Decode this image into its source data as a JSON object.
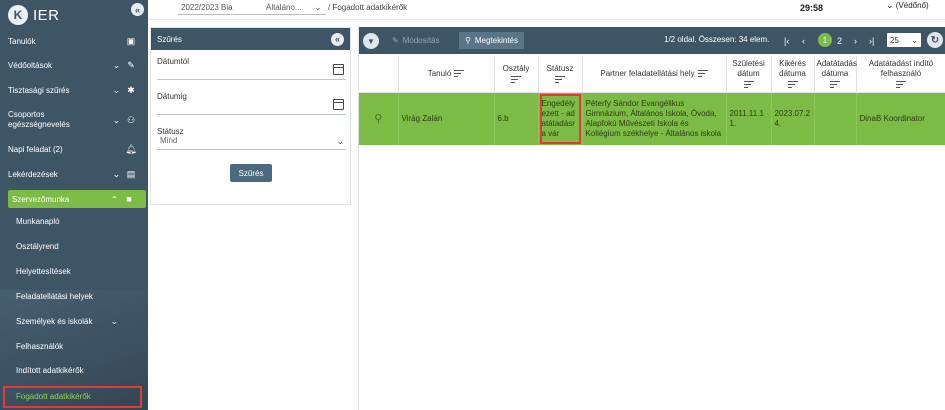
{
  "app": {
    "logo_letter": "K",
    "logo_text": "IER",
    "collapse_symbol": "«"
  },
  "sidebar": {
    "items": [
      {
        "label": "Tanulók",
        "icon": "id-card-icon"
      },
      {
        "label": "Védőoltások",
        "icon": "syringe-icon"
      },
      {
        "label": "Tisztasági szűrés",
        "icon": "bug-icon"
      },
      {
        "label": "Csoportos egészségnevelés",
        "icon": "group-icon"
      },
      {
        "label": "Napi feladat",
        "badge": "(2)",
        "icon": "bell-icon"
      },
      {
        "label": "Lekérdezések",
        "icon": "clipboard-icon"
      },
      {
        "label": "Szervezőmunka",
        "icon": "briefcase-icon"
      }
    ],
    "subitems": [
      "Munkanapló",
      "Osztályrend",
      "Helyettesítések",
      "Feladatellátási helyek",
      "Személyek és iskolák",
      "Felhasználók",
      "Indított adatkikérők",
      "Fogadott adatkikérők"
    ]
  },
  "topbar": {
    "school_year": "2022/2023 Bia",
    "selector": "Általáno...",
    "breadcrumb": "/ Fogadott adatkikérők",
    "timer": "29:58",
    "role": "(Védőnő)"
  },
  "filter": {
    "title": "Szűrés",
    "date_from_label": "Dátumtól",
    "date_to_label": "Dátumig",
    "status_label": "Státusz",
    "status_value": "Mind",
    "button_label": "Szűrés"
  },
  "toolbar": {
    "modify_label": "Módosítás",
    "view_label": "Megtekintés",
    "page_info": "1/2 oldal. Összesen: 34 elem.",
    "page_current": "1",
    "page_next": "2",
    "page_size": "25"
  },
  "table": {
    "headers": {
      "student": "Tanuló",
      "class": "Osztály",
      "status": "Státusz",
      "partner": "Partner feladatellátási hely",
      "birth": "Születési dátum",
      "request": "Kikérés dátuma",
      "transfer": "Adatátadás dátuma",
      "initiator": "Adatátadást indító felhasználó"
    },
    "rows": [
      {
        "student": "Virág Zalán",
        "class": "6.b",
        "status": "Engedélyezett - adatátadásra vár",
        "partner": "Péterfy Sándor Evangélikus Gimnázium, Általános Iskola, Óvoda, Alapfokú Művészeti Iskola és Kollégium székhelye - Általános iskola",
        "birth": "2011.11.11.",
        "request": "2023.07.24.",
        "transfer": "",
        "initiator": "DinaB Koordinator"
      }
    ]
  }
}
